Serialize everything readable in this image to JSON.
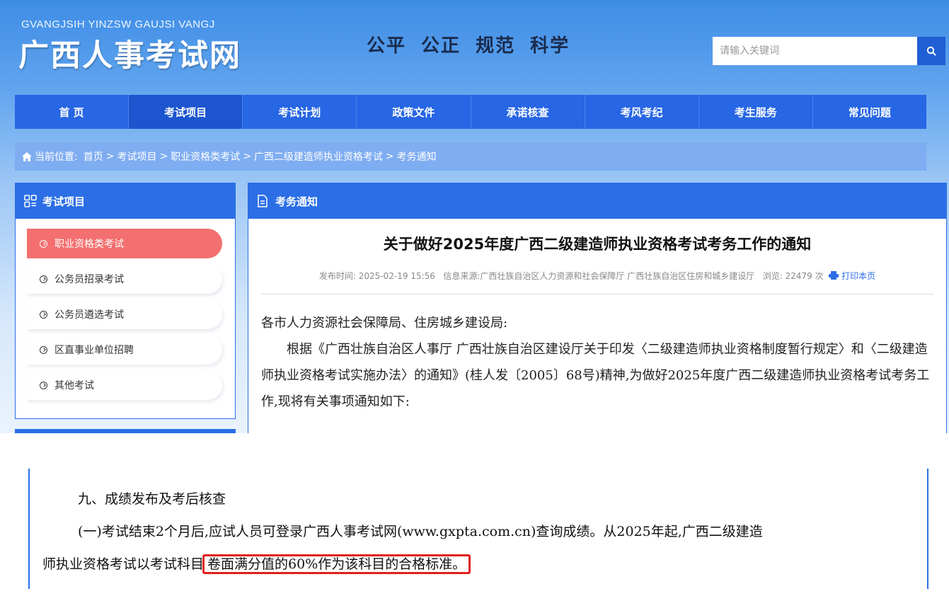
{
  "header": {
    "logo_pinyin": "GVANGJSIH YINZSW GAUJSI VANGJ",
    "logo_cn": "广西人事考试网",
    "slogan": "公平 公正 规范 科学",
    "search_placeholder": "请输入关键词"
  },
  "nav": {
    "items": [
      {
        "label": "首 页"
      },
      {
        "label": "考试项目"
      },
      {
        "label": "考试计划"
      },
      {
        "label": "政策文件"
      },
      {
        "label": "承诺核查"
      },
      {
        "label": "考风考纪"
      },
      {
        "label": "考生服务"
      },
      {
        "label": "常见问题"
      }
    ],
    "active_index": 1
  },
  "breadcrumb": {
    "prefix": "当前位置:",
    "items": [
      "首页",
      "考试项目",
      "职业资格类考试",
      "广西二级建造师执业资格考试",
      "考务通知"
    ],
    "separator": ">"
  },
  "sidebar": {
    "title": "考试项目",
    "items": [
      {
        "label": "职业资格类考试",
        "active": true
      },
      {
        "label": "公务员招录考试"
      },
      {
        "label": "公务员遴选考试"
      },
      {
        "label": "区直事业单位招聘"
      },
      {
        "label": "其他考试"
      }
    ]
  },
  "main": {
    "section_title": "考务通知",
    "article_title": "关于做好2025年度广西二级建造师执业资格考试考务工作的通知",
    "meta": {
      "publish_label": "发布时间:",
      "publish_time": "2025-02-19 15:56",
      "source_label": "信息来源:",
      "source": "广西壮族自治区人力资源和社会保障厅 广西壮族自治区住房和城乡建设厅",
      "views_label": "浏览:",
      "views": "22479",
      "views_unit": "次",
      "print_label": "打印本页"
    },
    "salutation": "各市人力资源社会保障局、住房城乡建设局:",
    "paragraph": "根据《广西壮族自治区人事厅 广西壮族自治区建设厅关于印发〈二级建造师执业资格制度暂行规定〉和〈二级建造师执业资格考试实施办法〉的通知》(桂人发〔2005〕68号)精神,为做好2025年度广西二级建造师执业资格考试考务工作,现将有关事项通知如下:"
  },
  "snippet": {
    "heading": "九、成绩发布及考后核查",
    "line1": "(一)考试结束2个月后,应试人员可登录广西人事考试网(www.gxpta.com.cn)查询成绩。从2025年起,广西二级建造",
    "line2_plain": "师执业资格考试以考试科目",
    "line2_highlight": "卷面满分值的60%作为该科目的合格标准。"
  },
  "colors": {
    "primary": "#2766e4",
    "active_sidebar": "#f46f6f",
    "highlight_box": "#e01e1e"
  }
}
